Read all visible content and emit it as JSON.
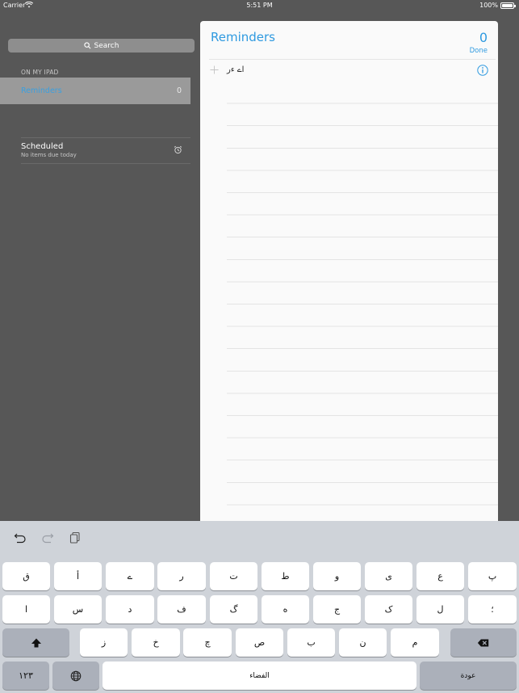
{
  "status_bar": {
    "carrier": "Carrier",
    "time": "5:51 PM",
    "battery": "100%"
  },
  "sidebar": {
    "search_label": "Search",
    "section_header": "ON MY IPAD",
    "lists": [
      {
        "label": "Reminders",
        "count": "0"
      }
    ],
    "scheduled": {
      "title": "Scheduled",
      "subtitle": "No items due today"
    }
  },
  "panel": {
    "title": "Reminders",
    "count": "0",
    "done_label": "Done",
    "reminder_text": "اے ءر"
  },
  "keyboard": {
    "row1": [
      "ق",
      "أ",
      "ے",
      "ر",
      "ت",
      "ط",
      "و",
      "ی",
      "ع",
      "پ"
    ],
    "row2": [
      "ا",
      "س",
      "د",
      "ف",
      "گ",
      "ه",
      "ج",
      "ک",
      "ل",
      "؛"
    ],
    "row3": [
      "ز",
      "خ",
      "چ",
      "ص",
      "ب",
      "ن",
      "م"
    ],
    "numbers_label": "١٢٣",
    "space_label": "الفضاء",
    "return_label": "عودة"
  },
  "colors": {
    "accent": "#2f9ae0",
    "sidebar_bg": "#575757",
    "keyboard_bg": "#cfd3d9"
  }
}
